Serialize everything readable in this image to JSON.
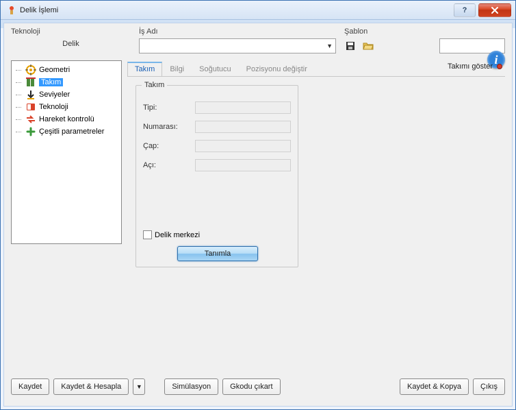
{
  "window": {
    "title": "Delik İşlemi"
  },
  "top": {
    "technology_label": "Teknoloji",
    "technology_value": "Delik",
    "job_name_label": "İş Adı",
    "template_label": "Şablon"
  },
  "tree": {
    "items": [
      {
        "label": "Geometri"
      },
      {
        "label": "Takım"
      },
      {
        "label": "Seviyeler"
      },
      {
        "label": "Teknoloji"
      },
      {
        "label": "Hareket kontrolü"
      },
      {
        "label": "Çeşitli parametreler"
      }
    ],
    "selected_index": 1
  },
  "tabs": {
    "items": [
      "Takım",
      "Bilgi",
      "Soğutucu",
      "Pozisyonu değiştir"
    ],
    "active_index": 0,
    "show_tool_label": "Takımı göster"
  },
  "toolgroup": {
    "title": "Takım",
    "fields": {
      "type_label": "Tipi:",
      "number_label": "Numarası:",
      "diameter_label": "Çap:",
      "angle_label": "Açı:"
    },
    "checkbox_label": "Delik merkezi",
    "define_button": "Tanımla"
  },
  "buttons": {
    "save": "Kaydet",
    "save_calc": "Kaydet & Hesapla",
    "simulate": "Simülasyon",
    "gcode": "Gkodu çıkart",
    "save_copy": "Kaydet & Kopya",
    "exit": "Çıkış"
  }
}
